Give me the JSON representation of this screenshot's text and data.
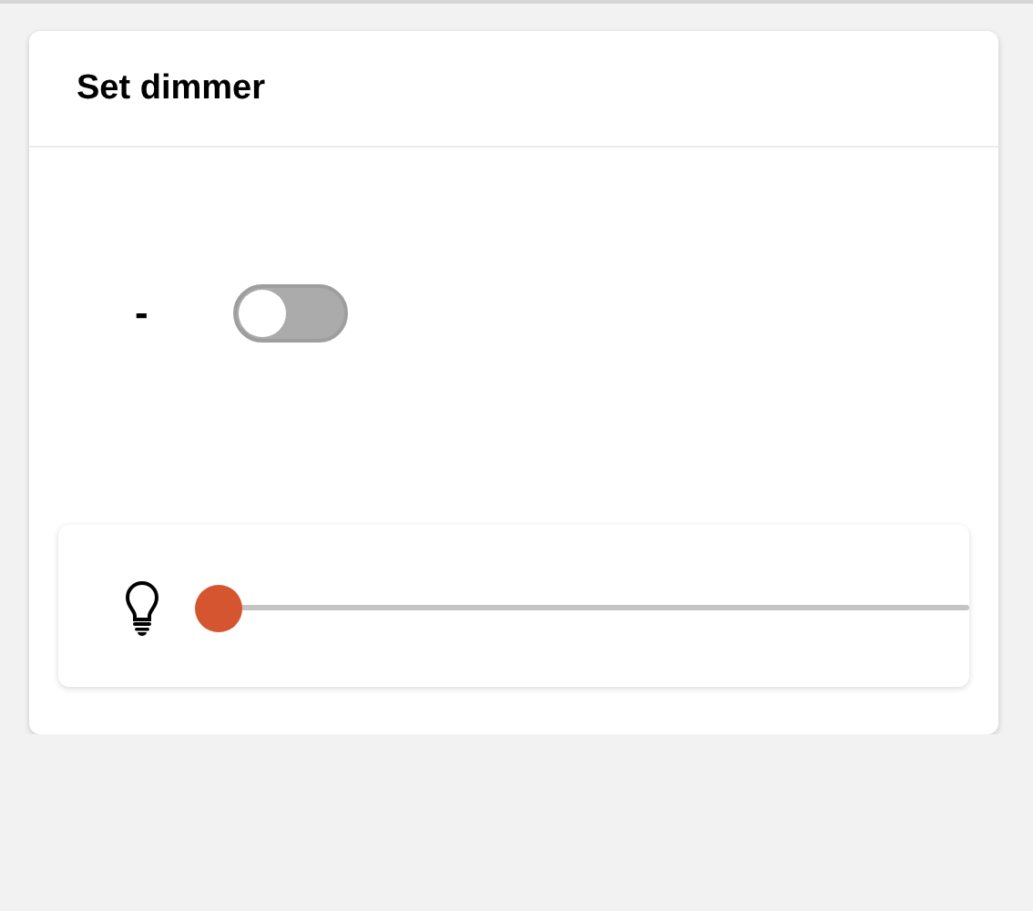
{
  "card": {
    "title": "Set dimmer"
  },
  "toggle": {
    "label": "-",
    "on": false
  },
  "dimmer": {
    "level": 0
  }
}
